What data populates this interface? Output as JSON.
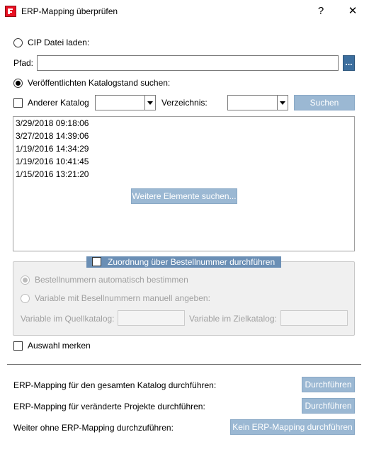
{
  "window": {
    "title": "ERP-Mapping überprüfen",
    "help_label": "?",
    "close_label": "✕"
  },
  "cip": {
    "radio_label": "CIP Datei laden:",
    "path_label": "Pfad:",
    "path_value": "",
    "browse_label": "..."
  },
  "published": {
    "radio_label": "Veröffentlichten Katalogstand suchen:"
  },
  "filter": {
    "other_catalog_label": "Anderer Katalog",
    "catalog_value": "",
    "directory_label": "Verzeichnis:",
    "directory_value": "",
    "search_label": "Suchen"
  },
  "versions": {
    "items": [
      "3/29/2018 09:18:06",
      "3/27/2018 14:39:06",
      "1/19/2016 14:34:29",
      "1/19/2016 10:41:45",
      "1/15/2016 13:21:20"
    ],
    "more_label": "Weitere Elemente suchen..."
  },
  "order_mapping": {
    "checkbox_label": "Zuordnung über Bestellnummer durchführen",
    "auto_label": "Bestellnummern automatisch bestimmen",
    "manual_label": "Variable mit Besellnummern manuell angeben:",
    "source_var_label": "Variable im Quellkatalog:",
    "source_var_value": "",
    "target_var_label": "Variable im Zielkatalog:",
    "target_var_value": ""
  },
  "remember": {
    "label": "Auswahl merken"
  },
  "actions": [
    {
      "text": "ERP-Mapping für den gesamten Katalog durchführen:",
      "button": "Durchführen"
    },
    {
      "text": "ERP-Mapping für veränderte Projekte durchführen:",
      "button": "Durchführen"
    },
    {
      "text": "Weiter ohne ERP-Mapping durchzuführen:",
      "button": "Kein ERP-Mapping durchführen"
    }
  ],
  "colors": {
    "button_disabled_bg": "#9bb8d3",
    "browse_bg": "#3c6e9e",
    "group_header": "#6b8fb5",
    "app_icon": "#e81123"
  }
}
